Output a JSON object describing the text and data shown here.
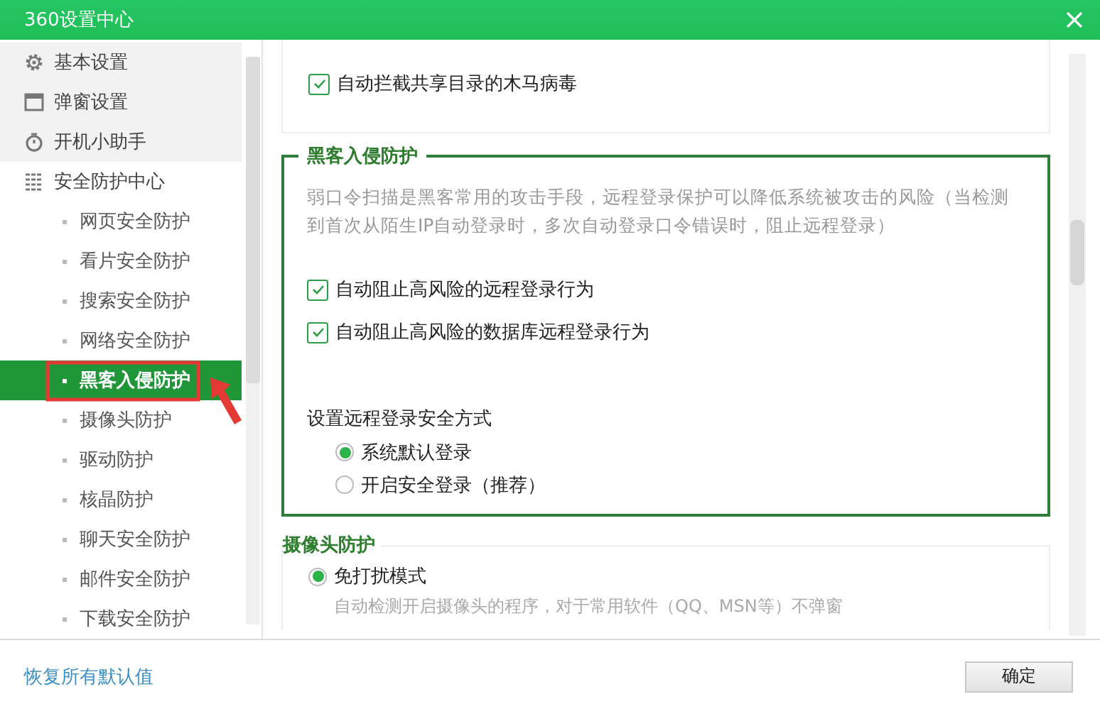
{
  "window": {
    "title": "360设置中心"
  },
  "sidebar": {
    "items": [
      {
        "label": "基本设置",
        "selected": false
      },
      {
        "label": "弹窗设置",
        "selected": false
      },
      {
        "label": "开机小助手",
        "selected": false
      },
      {
        "label": "安全防护中心",
        "selected": false,
        "children": [
          {
            "label": "网页安全防护",
            "selected": false
          },
          {
            "label": "看片安全防护",
            "selected": false
          },
          {
            "label": "搜索安全防护",
            "selected": false
          },
          {
            "label": "网络安全防护",
            "selected": false
          },
          {
            "label": "黑客入侵防护",
            "selected": true
          },
          {
            "label": "摄像头防护",
            "selected": false
          },
          {
            "label": "驱动防护",
            "selected": false
          },
          {
            "label": "核晶防护",
            "selected": false
          },
          {
            "label": "聊天安全防护",
            "selected": false
          },
          {
            "label": "邮件安全防护",
            "selected": false
          },
          {
            "label": "下载安全防护",
            "selected": false
          }
        ]
      }
    ]
  },
  "sections": [
    {
      "kind": "plain",
      "checkboxes": [
        {
          "label": "自动拦截共享目录的木马病毒",
          "checked": true
        }
      ]
    },
    {
      "kind": "group",
      "title": "黑客入侵防护",
      "description": "弱口令扫描是黑客常用的攻击手段，远程登录保护可以降低系统被攻击的风险（当检测到首次从陌生IP自动登录时，多次自动登录口令错误时，阻止远程登录）",
      "checkboxes": [
        {
          "label": "自动阻止高风险的远程登录行为",
          "checked": true
        },
        {
          "label": "自动阻止高风险的数据库远程登录行为",
          "checked": true
        }
      ],
      "radio_label": "设置远程登录安全方式",
      "radios": [
        {
          "label": "系统默认登录",
          "selected": true
        },
        {
          "label": "开启安全登录（推荐）",
          "selected": false
        }
      ]
    },
    {
      "kind": "card",
      "title": "摄像头防护",
      "radios": [
        {
          "label": "免打扰模式",
          "selected": true
        }
      ],
      "description": "自动检测开启摄像头的程序，对于常用软件（QQ、MSN等）不弹窗"
    }
  ],
  "footer": {
    "restore_link": "恢复所有默认值",
    "ok_button": "确定"
  }
}
